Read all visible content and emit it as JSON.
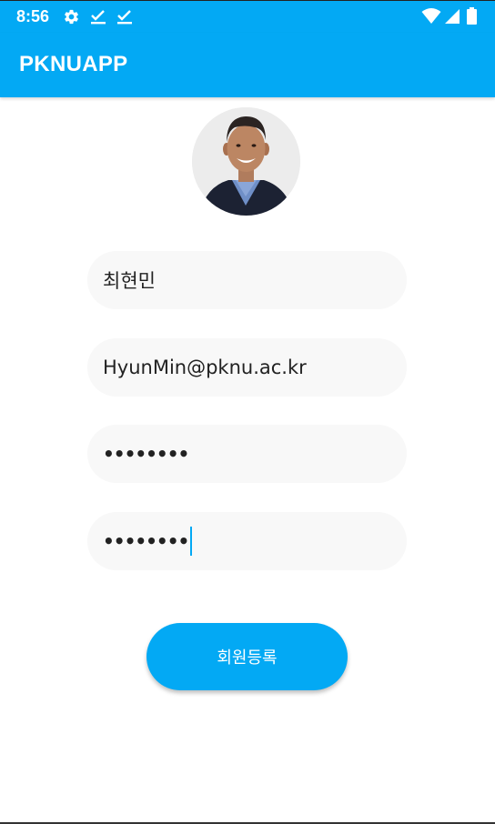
{
  "status_bar": {
    "time": "8:56",
    "left_icons": [
      "gear-icon",
      "download-done-icon",
      "download-done-icon"
    ],
    "right_icons": [
      "wifi-icon",
      "signal-icon",
      "battery-icon"
    ]
  },
  "app_bar": {
    "title": "PKNUAPP",
    "color": "#03A9F4"
  },
  "profile": {
    "avatar_icon": "profile-photo"
  },
  "form": {
    "name_value": "최현민",
    "email_value": "HyunMin@pknu.ac.kr",
    "password_value": "••••••••",
    "password_confirm_value": "••••••••"
  },
  "register_button": {
    "label": "회원등록"
  }
}
